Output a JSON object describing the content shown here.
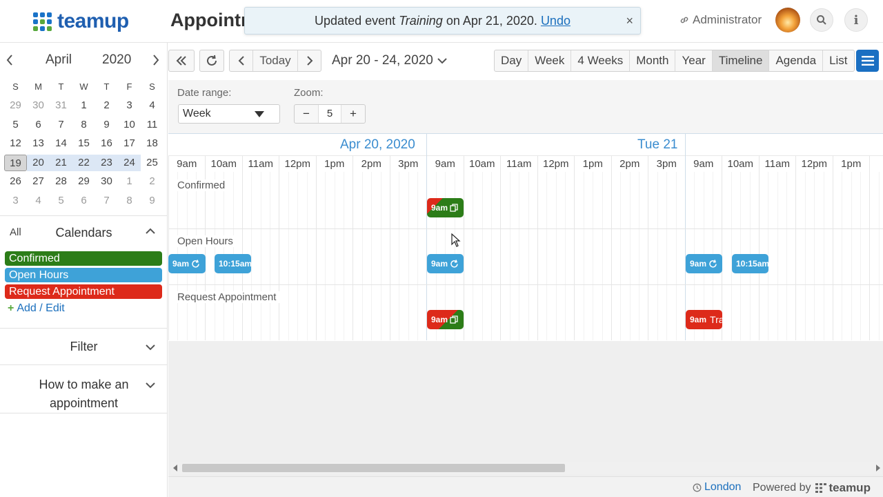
{
  "header": {
    "logo": "teamup",
    "page_title": "Appointments",
    "notice_prefix": "Updated event ",
    "notice_event": "Training",
    "notice_suffix": " on Apr 21, 2020.",
    "notice_undo": "Undo",
    "notice_close": "×",
    "user_label": "Administrator"
  },
  "mini_calendar": {
    "month": "April",
    "year": "2020",
    "dow": [
      "S",
      "M",
      "T",
      "W",
      "T",
      "F",
      "S"
    ],
    "weeks": [
      [
        "29",
        "30",
        "31",
        "1",
        "2",
        "3",
        "4"
      ],
      [
        "5",
        "6",
        "7",
        "8",
        "9",
        "10",
        "11"
      ],
      [
        "12",
        "13",
        "14",
        "15",
        "16",
        "17",
        "18"
      ],
      [
        "19",
        "20",
        "21",
        "22",
        "23",
        "24",
        "25"
      ],
      [
        "26",
        "27",
        "28",
        "29",
        "30",
        "1",
        "2"
      ],
      [
        "3",
        "4",
        "5",
        "6",
        "7",
        "8",
        "9"
      ]
    ]
  },
  "calendars": {
    "all_label": "All",
    "title": "Calendars",
    "items": [
      {
        "label": "Confirmed",
        "color": "#2c7d18"
      },
      {
        "label": "Open Hours",
        "color": "#3ea2d8"
      },
      {
        "label": "Request Appointment",
        "color": "#dd2a1a"
      }
    ],
    "add_edit": "Add / Edit"
  },
  "filter": {
    "title": "Filter"
  },
  "howto": {
    "title_line1": "How to make an",
    "title_line2": "appointment"
  },
  "toolbar": {
    "today": "Today",
    "range": "Apr 20 - 24, 2020",
    "views": [
      "Day",
      "Week",
      "4 Weeks",
      "Month",
      "Year",
      "Timeline",
      "Agenda",
      "List"
    ],
    "active_view": "Timeline"
  },
  "options": {
    "date_range_label": "Date range:",
    "date_range_value": "Week",
    "zoom_label": "Zoom:",
    "zoom_minus": "−",
    "zoom_value": "5",
    "zoom_plus": "+"
  },
  "timeline": {
    "days": [
      "Apr 20, 2020",
      "Tue 21"
    ],
    "hours": [
      "9am",
      "10am",
      "11am",
      "12pm",
      "1pm",
      "2pm",
      "3pm",
      "9am",
      "10am",
      "11am",
      "12pm",
      "1pm",
      "2pm",
      "3pm",
      "9am",
      "10am",
      "11am",
      "12pm",
      "1pm",
      "2"
    ],
    "rows": [
      "Confirmed",
      "Open Hours",
      "Request Appointment"
    ],
    "events": {
      "confirmed_1": "9am",
      "open_1": "9am",
      "open_2": "10:15am",
      "open_3": "9am",
      "open_4": "9am",
      "open_5": "10:15am",
      "request_1": "9am",
      "request_2": "9am",
      "request_2_title": "Tra"
    }
  },
  "footer": {
    "timezone": "London",
    "powered_by": "Powered by",
    "brand": "teamup"
  }
}
